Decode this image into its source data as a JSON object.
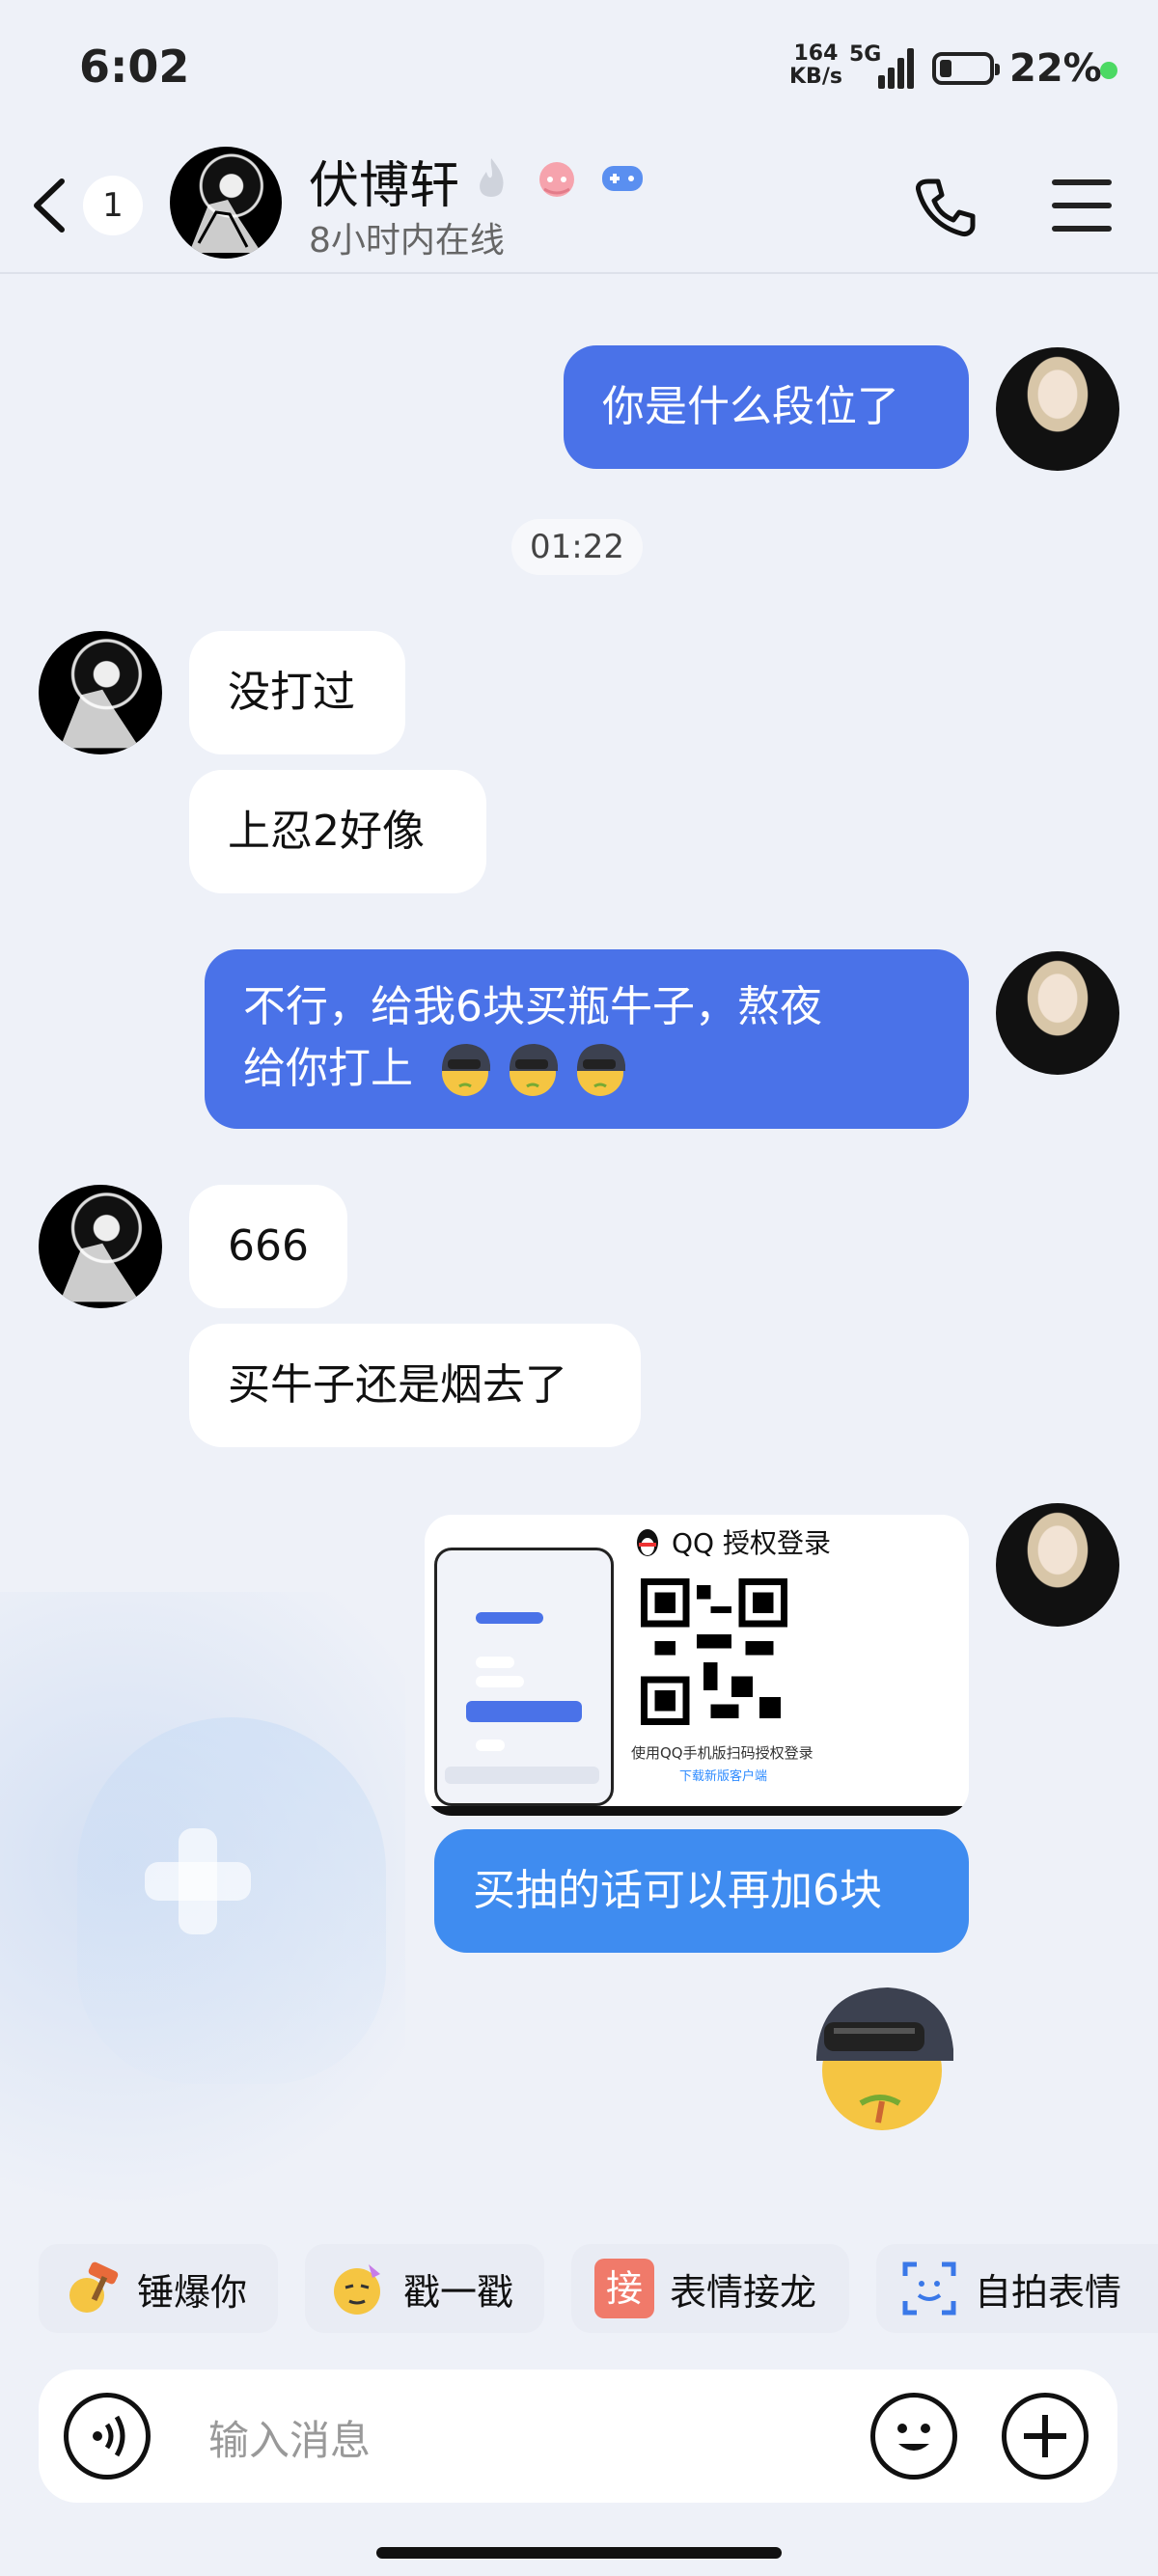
{
  "status_bar": {
    "time": "6:02",
    "net_speed_value": "164",
    "net_speed_unit": "KB/s",
    "network": "5G",
    "battery": "22%",
    "battery_level": 0.22,
    "accent_dot_color": "#4cd964"
  },
  "header": {
    "unread_count": "1",
    "contact_name": "伏博轩",
    "online_status": "8小时内在线",
    "icons": [
      "back-arrow-icon",
      "flame-icon",
      "pink-cloud-icon",
      "game-controller-icon",
      "phone-icon",
      "menu-icon"
    ]
  },
  "messages": [
    {
      "side": "right",
      "text": "你是什么段位了"
    },
    {
      "type": "time",
      "text": "01:22"
    },
    {
      "side": "left",
      "text": "没打过"
    },
    {
      "side": "left",
      "text": "上忍2好像"
    },
    {
      "side": "right",
      "text": "不行，给我6块买瓶牛子，熬夜\n给你打上",
      "emoji": "helmet-emoji"
    },
    {
      "side": "left",
      "text": "666"
    },
    {
      "side": "left",
      "text": "买牛子还是烟去了"
    },
    {
      "side": "right",
      "type": "image-card",
      "card": {
        "title": "QQ 授权登录",
        "tip": "使用QQ手机版扫码授权登录",
        "link": "下载新版客户端"
      }
    },
    {
      "side": "right",
      "text": "买抽的话可以再加6块"
    },
    {
      "side": "right",
      "type": "sticker",
      "sticker": "helmet-emoji-sticker"
    }
  ],
  "quick_actions": [
    {
      "label": "锤爆你",
      "icon": "hammer-icon"
    },
    {
      "label": "戳一戳",
      "icon": "poke-emoji-icon"
    },
    {
      "label": "表情接龙",
      "icon": "jie-badge-icon",
      "badge": "接"
    },
    {
      "label": "自拍表情",
      "icon": "selfie-face-icon"
    }
  ],
  "input": {
    "placeholder": "输入消息"
  },
  "colors": {
    "bubble_right": "#4a72e8",
    "bubble_right_alt": "#3f8cf0",
    "bubble_left": "#ffffff",
    "background": "#eef1f8"
  }
}
